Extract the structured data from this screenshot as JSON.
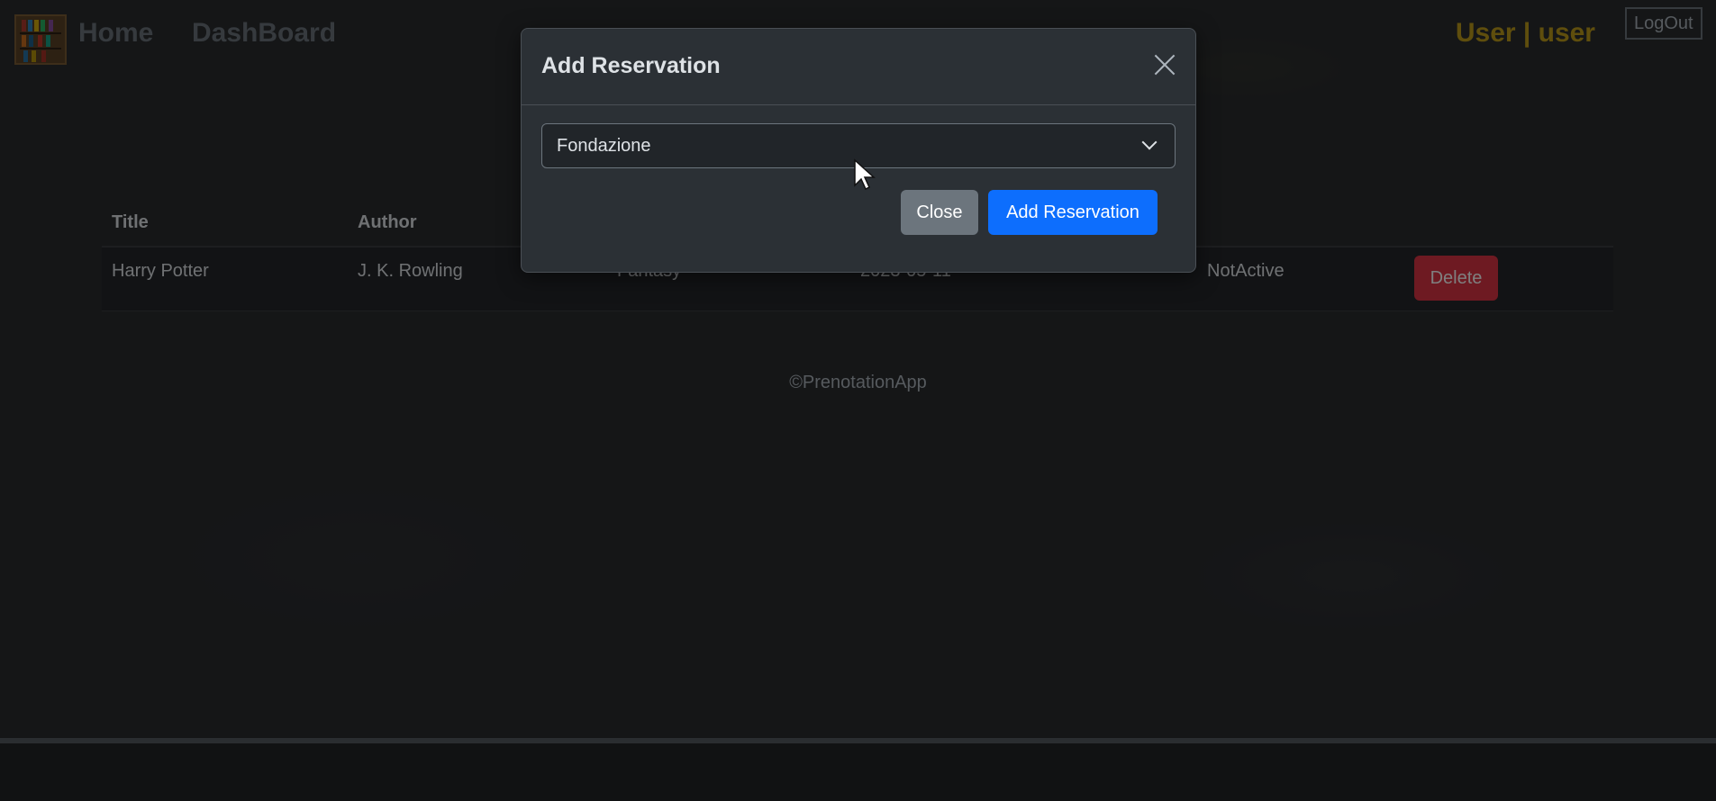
{
  "navbar": {
    "home": "Home",
    "dashboard": "DashBoard",
    "user_label": "User | user",
    "logout": "LogOut",
    "logo_icon": "bookshelf-icon"
  },
  "table": {
    "headers": [
      "Title",
      "Author"
    ],
    "rows": [
      {
        "title": "Harry Potter",
        "author": "J. K. Rowling",
        "genre": "Fantasy",
        "date": "2023-05-11",
        "status": "NotActive",
        "delete_label": "Delete"
      }
    ]
  },
  "footer": {
    "text": "©PrenotationApp"
  },
  "modal": {
    "title": "Add Reservation",
    "select_value": "Fondazione",
    "close_label": "Close",
    "submit_label": "Add Reservation",
    "close_icon": "close-icon",
    "dropdown_icon": "chevron-down-icon"
  },
  "colors": {
    "accent": "#0d6efd",
    "danger": "#dc3545",
    "secondary": "#6c757d",
    "user_label": "#bf9c1a"
  }
}
